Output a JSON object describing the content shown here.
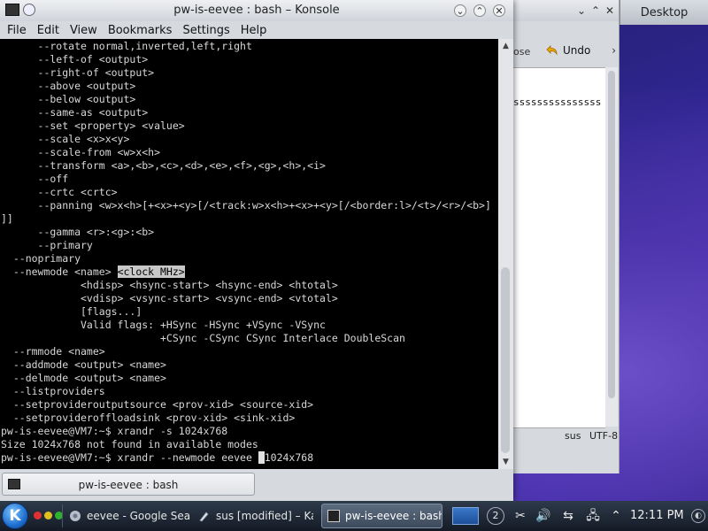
{
  "desktop": {
    "label": "Desktop"
  },
  "kate": {
    "toolbar": {
      "close_fragment": "ose",
      "undo_label": "Undo",
      "more": "›"
    },
    "editor_line": "sssssssssssssss",
    "status": {
      "mode": "sus",
      "encoding": "UTF-8"
    }
  },
  "konsole": {
    "title": "pw-is-eevee : bash – Konsole",
    "menu": [
      "File",
      "Edit",
      "View",
      "Bookmarks",
      "Settings",
      "Help"
    ],
    "terminal_lines": [
      "      --rotate normal,inverted,left,right",
      "      --left-of <output>",
      "      --right-of <output>",
      "      --above <output>",
      "      --below <output>",
      "      --same-as <output>",
      "      --set <property> <value>",
      "      --scale <x>x<y>",
      "      --scale-from <w>x<h>",
      "      --transform <a>,<b>,<c>,<d>,<e>,<f>,<g>,<h>,<i>",
      "      --off",
      "      --crtc <crtc>",
      "      --panning <w>x<h>[+<x>+<y>[/<track:w>x<h>+<x>+<y>[/<border:l>/<t>/<r>/<b>]",
      "]]",
      "      --gamma <r>:<g>:<b>",
      "      --primary",
      "  --noprimary",
      "  --newmode <name> ",
      "             <hdisp> <hsync-start> <hsync-end> <htotal>",
      "             <vdisp> <vsync-start> <vsync-end> <vtotal>",
      "             [flags...]",
      "             Valid flags: +HSync -HSync +VSync -VSync",
      "                          +CSync -CSync CSync Interlace DoubleScan",
      "  --rmmode <name>",
      "  --addmode <output> <name>",
      "  --delmode <output> <name>",
      "  --listproviders",
      "  --setprovideroutputsource <prov-xid> <source-xid>",
      "  --setprovideroffloadsink <prov-xid> <sink-xid>",
      "pw-is-eevee@VM7:~$ xrandr -s 1024x768",
      "Size 1024x768 not found in available modes",
      "pw-is-eevee@VM7:~$ xrandr --newmode eevee "
    ],
    "highlighted_text": "<clock MHz>",
    "cursor_char": " ",
    "after_cursor": "1024x768",
    "tab_label": "pw-is-eevee : bash"
  },
  "taskbar": {
    "k_label": "K",
    "dot_colors": [
      "#e03030",
      "#e0c020",
      "#30b030"
    ],
    "tasks": [
      {
        "label": "eevee - Google Sea",
        "icon": "chrome-icon"
      },
      {
        "label": "sus [modified] – Kat",
        "icon": "kate-icon"
      },
      {
        "label": "pw-is-eevee : bash",
        "icon": "konsole-icon"
      }
    ],
    "tray_badge": "2",
    "clock": "12:11 PM"
  }
}
